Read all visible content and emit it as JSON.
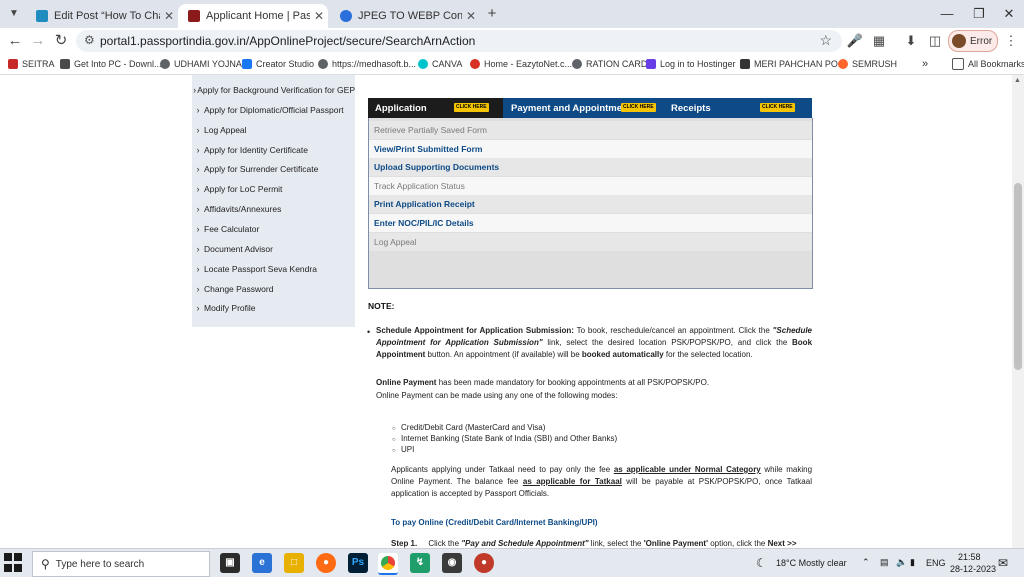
{
  "browser": {
    "tabs": [
      {
        "title": "Edit Post “How To Change Tatka",
        "active": false,
        "favicon_color": "#1e8cbe"
      },
      {
        "title": "Applicant Home | Passport Seva",
        "active": true,
        "favicon_color": "#8b1a1a"
      },
      {
        "title": "JPEG TO WEBP Convertor Tool |",
        "active": false,
        "favicon_color": "#2a6fdb"
      }
    ],
    "new_tab_icon": "plus-icon",
    "url": "portal1.passportindia.gov.in/AppOnlineProject/secure/SearchArnAction",
    "profile_label": "Error",
    "bookmarks": [
      {
        "label": "SEITRA",
        "color": "#c62828"
      },
      {
        "label": "Get Into PC - Downl...",
        "color": "#4a4a4a"
      },
      {
        "label": "UDHAMI YOJNA",
        "color": "#5f6368"
      },
      {
        "label": "Creator Studio",
        "color": "#1877f2"
      },
      {
        "label": "https://medhasoft.b...",
        "color": "#5f6368"
      },
      {
        "label": "CANVA",
        "color": "#00c4cc"
      },
      {
        "label": "Home - EazytoNet.c...",
        "color": "#d93025"
      },
      {
        "label": "RATION CARD",
        "color": "#5f6368"
      },
      {
        "label": "Log in to Hostinger",
        "color": "#673de6"
      },
      {
        "label": "MERI PAHCHAN PO...",
        "color": "#333333"
      },
      {
        "label": "SEMRUSH",
        "color": "#ff642d"
      }
    ],
    "bookmarks_overflow": "»",
    "all_bookmarks": "All Bookmarks"
  },
  "sidebar": {
    "items": [
      "Apply for Background Verification for GEP",
      "Apply for Diplomatic/Official Passport",
      "Log Appeal",
      "Apply for Identity Certificate",
      "Apply for Surrender Certificate",
      "Apply for LoC Permit",
      "Affidavits/Annexures",
      "Fee Calculator",
      "Document Advisor",
      "Locate Passport Seva Kendra",
      "Change Password",
      "Modify Profile"
    ]
  },
  "page_tabs": {
    "application": "Application",
    "payment": "Payment and Appointment",
    "receipts": "Receipts",
    "click_here": "CLICK HERE"
  },
  "menu": [
    {
      "label": "Retrieve Partially Saved Form",
      "state": "disabled"
    },
    {
      "label": "View/Print Submitted Form",
      "state": "link"
    },
    {
      "label": "Upload Supporting Documents",
      "state": "link"
    },
    {
      "label": "Track Application Status",
      "state": "disabled"
    },
    {
      "label": "Print Application Receipt",
      "state": "link"
    },
    {
      "label": "Enter NOC/PIL/IC Details",
      "state": "link"
    },
    {
      "label": "Log Appeal",
      "state": "disabled"
    }
  ],
  "note": {
    "heading": "NOTE:",
    "schedule_bold": "Schedule Appointment for Application Submission:",
    "schedule_text1": " To book, reschedule/cancel an appointment. Click the ",
    "schedule_link": "\"Schedule Appointment for Application Submission\"",
    "schedule_text2": " link, select the desired location PSK/POPSK/PO, and click the ",
    "book_appointment": "Book Appointment",
    "schedule_text3": " button. An appointment (if available) will be ",
    "booked_auto": "booked automatically",
    "schedule_text4": " for the selected location.",
    "online_payment_bold": "Online Payment",
    "online_payment_text": " has been made mandatory for booking appointments at all PSK/POPSK/PO.",
    "modes_intro": "Online Payment can be made using any one of the following modes:",
    "modes": [
      "Credit/Debit Card (MasterCard and Visa)",
      "Internet Banking (State Bank of India (SBI) and Other Banks)",
      "UPI"
    ],
    "tatkal_text1": "Applicants applying under Tatkaal need to pay only the fee ",
    "tatkal_normal": "as applicable under Normal Category",
    "tatkal_text2": " while making Online Payment. The balance fee ",
    "tatkal_tatkaal": "as applicable for Tatkaal",
    "tatkal_text3": " will be payable at PSK/POPSK/PO, once Tatkaal application is accepted by Passport Officials.",
    "pay_online": "To pay Online (Credit/Debit Card/Internet Banking/UPI)",
    "step1_label": "Step 1.",
    "step1_text1": "Click the ",
    "step1_link": "\"Pay and Schedule Appointment\"",
    "step1_text2": " link, select the ",
    "step1_option": "'Online Payment'",
    "step1_text3": " option, click the ",
    "step1_next": "Next >>"
  },
  "taskbar": {
    "search_placeholder": "Type here to search",
    "weather": "18°C  Mostly clear",
    "lang": "ENG",
    "time": "21:58",
    "date": "28-12-2023"
  }
}
